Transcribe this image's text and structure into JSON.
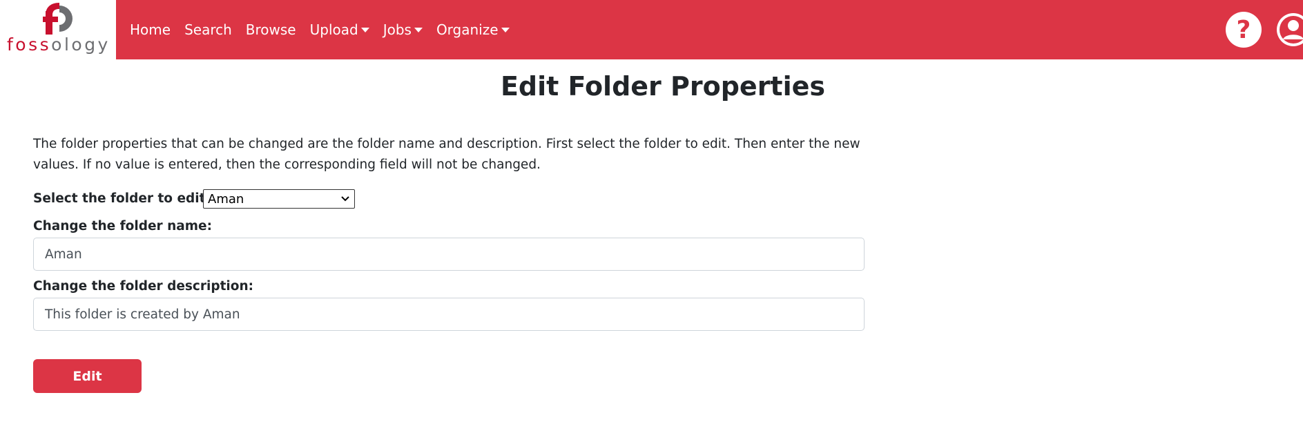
{
  "app": {
    "logo_text_red": "foss",
    "logo_text_gray": "ology",
    "brand_color": "#dc3545"
  },
  "nav": {
    "items": [
      {
        "label": "Home",
        "has_dropdown": false
      },
      {
        "label": "Search",
        "has_dropdown": false
      },
      {
        "label": "Browse",
        "has_dropdown": false
      },
      {
        "label": "Upload",
        "has_dropdown": true
      },
      {
        "label": "Jobs",
        "has_dropdown": true
      },
      {
        "label": "Organize",
        "has_dropdown": true
      }
    ],
    "help_icon": "question-circle-icon",
    "user_icon": "user-circle-icon"
  },
  "main": {
    "title": "Edit Folder Properties",
    "description_line1": "The folder properties that can be changed are the folder name and description. First select the folder to edit. Then enter the new",
    "description_line2": "values. If no value is entered, then the corresponding field will not be changed.",
    "select_label": "Select the folder to edit:",
    "select_value": "Aman",
    "name_label": "Change the folder name:",
    "name_value": "Aman",
    "description_label": "Change the folder description:",
    "description_value": "This folder is created by Aman",
    "edit_button": "Edit"
  }
}
